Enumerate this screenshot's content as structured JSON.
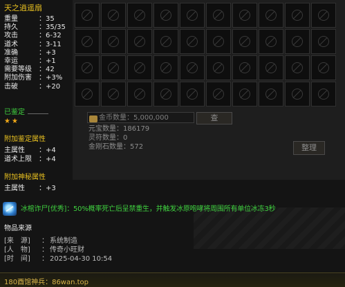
{
  "item": {
    "name": "天之逍遥扇",
    "stats": [
      {
        "label": "重量",
        "value": "35"
      },
      {
        "label": "持久",
        "value": "35/35"
      },
      {
        "label": "攻击",
        "value": "6-32"
      },
      {
        "label": "道术",
        "value": "3-11"
      },
      {
        "label": "准确",
        "value": "+3"
      },
      {
        "label": "幸运",
        "value": "+1"
      },
      {
        "label": "需要等级",
        "value": "42"
      },
      {
        "label": "附加伤害",
        "value": "+3%"
      },
      {
        "label": "击破",
        "value": "+20"
      }
    ],
    "appraised_label": "已鉴定",
    "stars": 2,
    "star_glyph": "★",
    "appraise_section": {
      "title": "附加鉴定属性",
      "stats": [
        {
          "label": "主属性",
          "value": "+4"
        },
        {
          "label": "道术上限",
          "value": "+4"
        }
      ]
    },
    "mystic_section": {
      "title": "附加神秘属性",
      "stats": [
        {
          "label": "主属性",
          "value": "+3"
        }
      ]
    },
    "skill_effect": {
      "prefix": "冰棺诈尸[优秀]：",
      "text": "50%概率死亡后呈禁重生，并触发冰原咆哮将周围所有单位冰冻3秒",
      "icon": "ice-skill-icon"
    },
    "source": {
      "title": "物品来源",
      "rows": [
        {
          "key": "[来　源]",
          "value": "系统制造"
        },
        {
          "key": "[人　物]",
          "value": "传奇小旺财"
        },
        {
          "key": "[时　间]",
          "value": "2025-04-30 10:54"
        }
      ]
    }
  },
  "colon": "：",
  "bag": {
    "gold_label": "金币数量",
    "gold_value": "5,000,000",
    "yuanbao_label": "元宝数量",
    "yuanbao_value": "186179",
    "lingfu_label": "灵符数量",
    "lingfu_value": "0",
    "diamond_label": "金刚石数量",
    "diamond_value": "572",
    "deposit_button": "查",
    "sort_button": "整理"
  },
  "footer": {
    "text": "180酉馆神兵：86wan.top"
  },
  "colors": {
    "title": "#e8c020",
    "green": "#3fd13f",
    "footer": "#d9b54a"
  }
}
